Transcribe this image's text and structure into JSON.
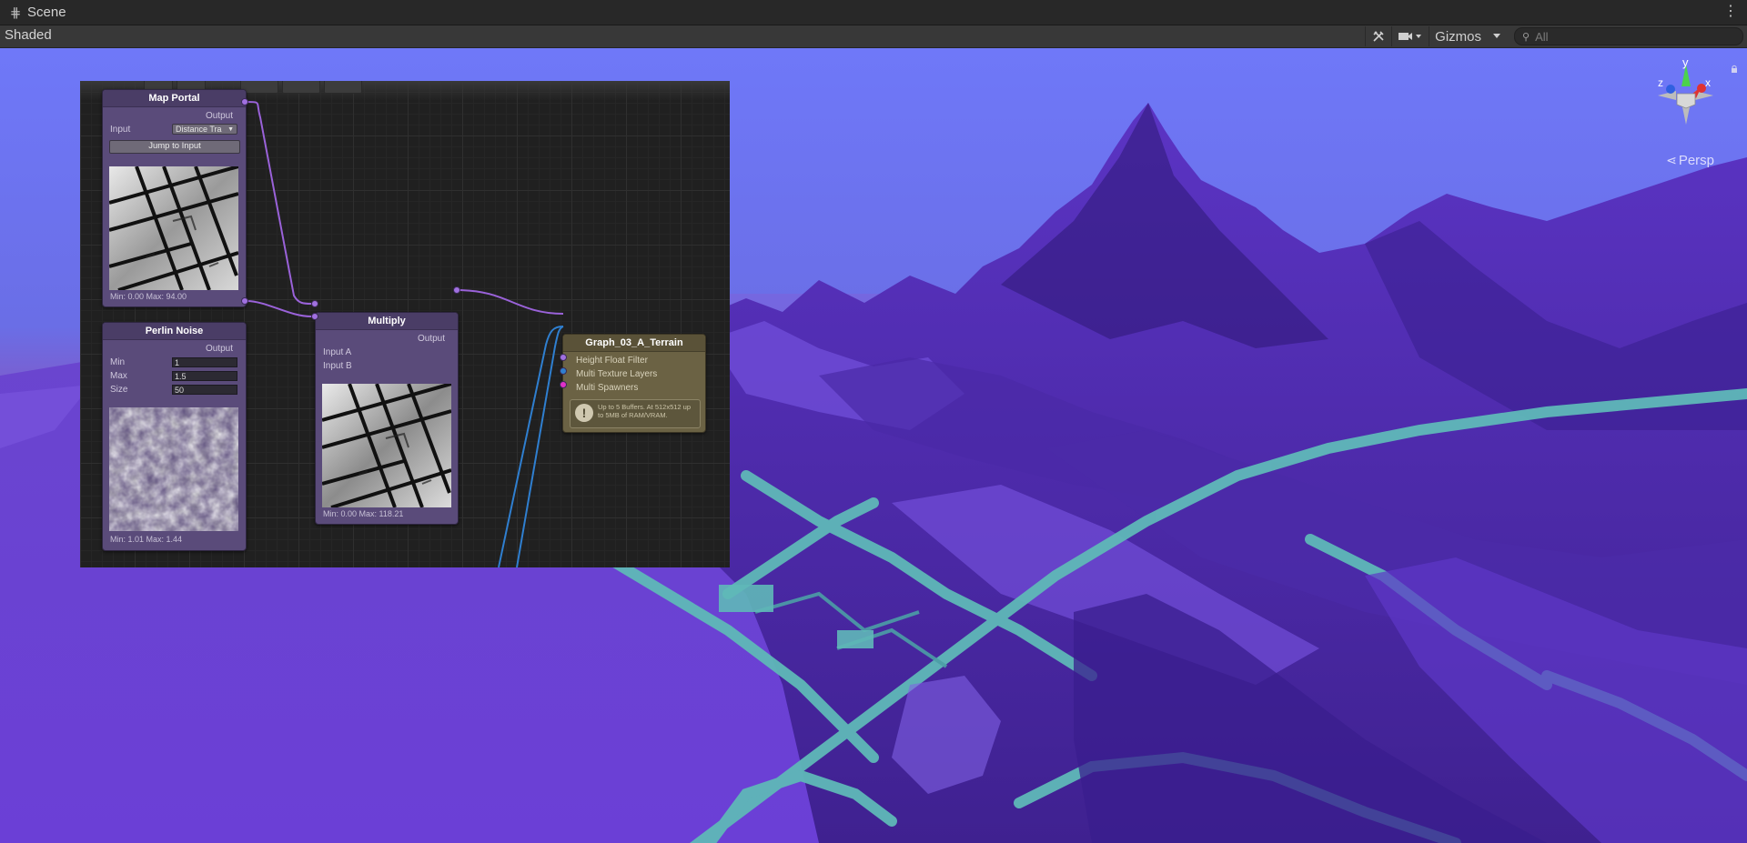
{
  "window": {
    "title": "Scene"
  },
  "toolbar": {
    "shading_mode": "Shaded",
    "gizmos_label": "Gizmos",
    "search_placeholder": "All"
  },
  "viewport": {
    "camera_mode": "Persp",
    "axes": {
      "x": "x",
      "y": "y",
      "z": "z"
    }
  },
  "graph": {
    "map_portal": {
      "title": "Map Portal",
      "output_label": "Output",
      "input_label": "Input",
      "input_value": "Distance Tra",
      "jump_button": "Jump to Input",
      "stats": "Min: 0.00 Max: 94.00"
    },
    "perlin_noise": {
      "title": "Perlin Noise",
      "output_label": "Output",
      "min_label": "Min",
      "min_value": "1",
      "max_label": "Max",
      "max_value": "1.5",
      "size_label": "Size",
      "size_value": "50",
      "stats": "Min: 1.01 Max: 1.44"
    },
    "multiply": {
      "title": "Multiply",
      "output_label": "Output",
      "input_a": "Input A",
      "input_b": "Input B",
      "stats": "Min: 0.00 Max: 118.21"
    },
    "terrain_output": {
      "title": "Graph_03_A_Terrain",
      "inputs": [
        "Height Float Filter",
        "Multi Texture Layers",
        "Multi Spawners"
      ],
      "warning": "Up to 5 Buffers. At 512x512 up to 5MB of RAM/VRAM."
    }
  },
  "colors": {
    "sky_top": "#6f78f8",
    "terrain": "#6a3bd6",
    "road": "#5fb8b8",
    "node_body": "#5a4b7a",
    "output_node": "#6b6244",
    "wire_purple": "#9a62d9",
    "wire_blue": "#2f7fd0"
  }
}
